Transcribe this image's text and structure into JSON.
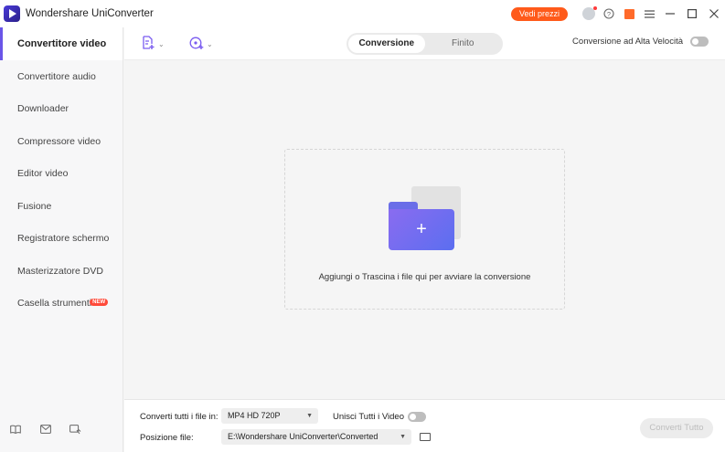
{
  "app": {
    "title": "Wondershare UniConverter",
    "pricing_button": "Vedi prezzi",
    "accent_color": "#6a55e8",
    "pricing_color": "#ff5a1a"
  },
  "titlebar_icons": [
    "user-icon",
    "help-icon",
    "gift-icon",
    "menu-icon",
    "minimize-icon",
    "maximize-icon",
    "close-icon"
  ],
  "sidebar": {
    "items": [
      {
        "label": "Convertitore video",
        "active": true
      },
      {
        "label": "Convertitore audio"
      },
      {
        "label": "Downloader"
      },
      {
        "label": "Compressore video"
      },
      {
        "label": "Editor video"
      },
      {
        "label": "Fusione"
      },
      {
        "label": "Registratore schermo"
      },
      {
        "label": "Masterizzatore DVD"
      },
      {
        "label": "Casella strumenti",
        "badge": "NEW"
      }
    ],
    "bottom_icons": [
      "book-icon",
      "mail-icon",
      "feedback-icon"
    ]
  },
  "toolbar": {
    "add_file_icon": "add-file-icon",
    "add_media_icon": "add-media-icon",
    "tabs": [
      {
        "label": "Conversione",
        "active": true
      },
      {
        "label": "Finito"
      }
    ],
    "high_speed_label": "Conversione ad Alta Velocità",
    "high_speed_enabled": false
  },
  "dropzone": {
    "text": "Aggiungi o Trascina i file qui per avviare la conversione",
    "plus": "+"
  },
  "bottom": {
    "convert_all_label": "Converti tutti i file in:",
    "format_value": "MP4 HD 720P",
    "merge_label": "Unisci Tutti i Video",
    "merge_enabled": false,
    "location_label": "Posizione file:",
    "location_value": "E:\\Wondershare UniConverter\\Converted",
    "convert_button": "Converti Tutto"
  }
}
